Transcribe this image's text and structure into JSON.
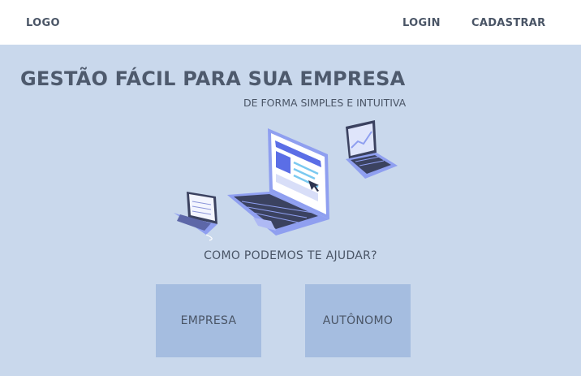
{
  "header": {
    "logo": "LOGO",
    "login": "LOGIN",
    "signup": "CADASTRAR"
  },
  "hero": {
    "title": "GESTÃO FÁCIL PARA SUA EMPRESA",
    "subtitle": "DE FORMA SIMPLES E INTUITIVA"
  },
  "prompt": {
    "question": "COMO PODEMOS TE AJUDAR?",
    "options": [
      {
        "label": "EMPRESA"
      },
      {
        "label": "AUTÔNOMO"
      }
    ]
  },
  "illustration": {
    "icons": [
      "laptop-icon",
      "small-laptop-icon",
      "chart-laptop-icon",
      "cursor-icon"
    ]
  },
  "colors": {
    "background": "#c9d8ec",
    "header": "#ffffff",
    "button": "#a5bde0",
    "text": "#4a5566",
    "laptop_body": "#8f9ff0",
    "screen_accent": "#5b6ee6"
  }
}
